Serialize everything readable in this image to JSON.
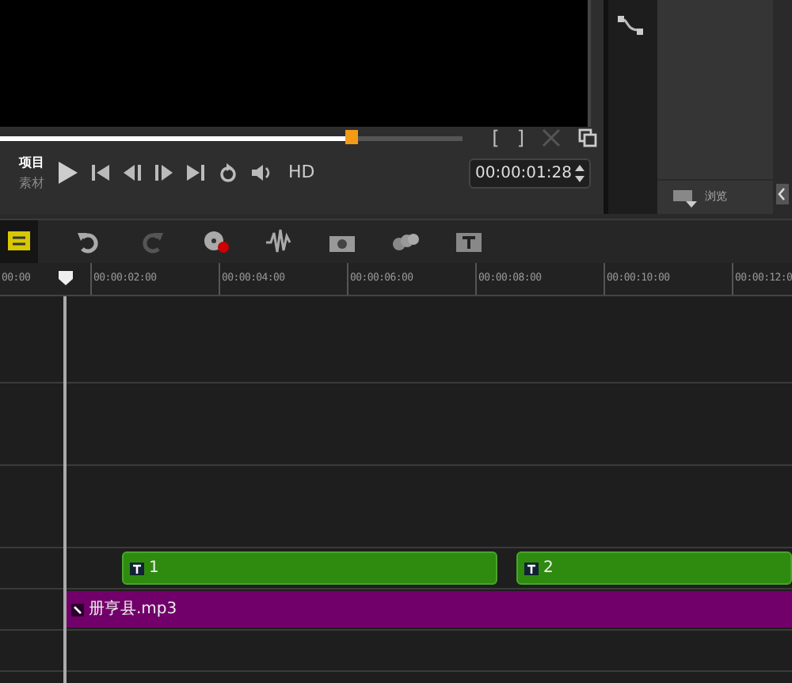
{
  "player": {
    "mode_labels": [
      {
        "label": "项目",
        "selected": true
      },
      {
        "label": "素材",
        "selected": false
      }
    ],
    "scrubber": {
      "level": 0.76
    },
    "mark_in": "[",
    "mark_out": "]",
    "hd": "HD",
    "timecode": "00:00:01:28"
  },
  "library": {
    "browse": "浏览"
  },
  "toolbar": {
    "tools": [
      {
        "selected": true
      },
      {
        "selected": false
      },
      {
        "selected": false
      },
      {
        "selected": false
      },
      {
        "selected": false
      },
      {
        "selected": false
      },
      {
        "selected": false
      },
      {
        "selected": false
      }
    ]
  },
  "ruler": [
    "00:00",
    "00:00:02:00",
    "00:00:04:00",
    "00:00:06:00",
    "00:00:08:00",
    "00:00:10:00",
    "00:00:12:0"
  ],
  "tracks": [
    {
      "kind": "video"
    },
    {
      "kind": "overlay"
    },
    {
      "kind": "overlay"
    },
    {
      "kind": "title",
      "clips": [
        {
          "label": "1"
        },
        {
          "label": "2"
        }
      ]
    },
    {
      "kind": "music",
      "clips": [
        {
          "label": "册亨县.mp3"
        }
      ]
    },
    {
      "kind": "music"
    }
  ]
}
